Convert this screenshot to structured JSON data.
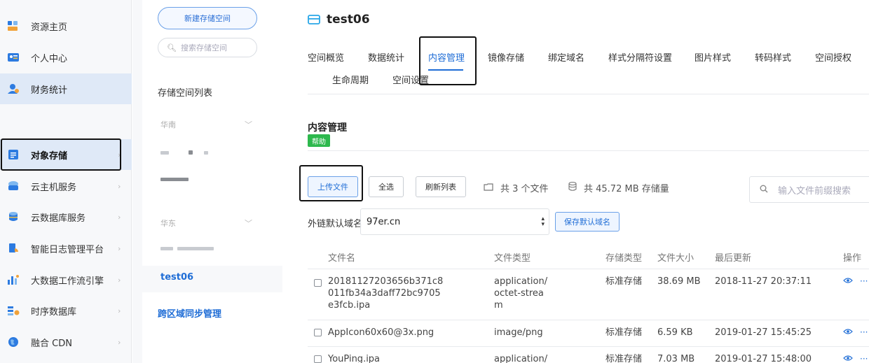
{
  "nav": {
    "items": [
      {
        "label": "资源主页",
        "icon": "resource-home-icon"
      },
      {
        "label": "个人中心",
        "icon": "profile-card-icon"
      },
      {
        "label": "财务统计",
        "icon": "finance-user-icon"
      },
      {
        "label": "对象存储",
        "icon": "object-storage-icon"
      },
      {
        "label": "云主机服务",
        "icon": "cloud-host-icon"
      },
      {
        "label": "云数据库服务",
        "icon": "cloud-database-icon"
      },
      {
        "label": "智能日志管理平台",
        "icon": "log-platform-icon"
      },
      {
        "label": "大数据工作流引擎",
        "icon": "bigdata-workflow-icon"
      },
      {
        "label": "时序数据库",
        "icon": "timeseries-db-icon"
      },
      {
        "label": "融合 CDN",
        "icon": "cdn-globe-icon"
      }
    ]
  },
  "buckets": {
    "new_button": "新建存储空间",
    "search_placeholder": "搜索存储空间",
    "list_title": "存储空间列表",
    "regions": [
      "华南",
      "华东"
    ],
    "active_bucket": "test06",
    "cross_region_link": "跨区域同步管理"
  },
  "space": {
    "title": "test06",
    "tabs": [
      "空间概览",
      "数据统计",
      "内容管理",
      "镜像存储",
      "绑定域名",
      "样式分隔符设置",
      "图片样式",
      "转码样式",
      "空间授权",
      "生命周期",
      "空间设置"
    ],
    "active_tab": "内容管理"
  },
  "content": {
    "section_title": "内容管理",
    "help_badge": "帮助",
    "upload_button": "上传文件",
    "select_all_button": "全选",
    "refresh_button": "刷新列表",
    "file_count": "共 3 个文件",
    "storage_total": "共 45.72 MB 存储量",
    "search_placeholder": "输入文件前缀搜索",
    "domain_label": "外链默认域名",
    "domain_value": "97er.cn",
    "save_domain_button": "保存默认域名",
    "columns": [
      "文件名",
      "文件类型",
      "存储类型",
      "文件大小",
      "最后更新",
      "操作"
    ],
    "files": [
      {
        "name": [
          "20181127203656b371c8",
          "011fb34a3daff72bc9705",
          "e3fcb.ipa"
        ],
        "type": [
          "application/",
          "octet-strea",
          "m"
        ],
        "storage": "标准存储",
        "size": "38.69 MB",
        "updated": "2018-11-27 20:37:11"
      },
      {
        "name": [
          "AppIcon60x60@3x.png"
        ],
        "type": [
          "image/png"
        ],
        "storage": "标准存储",
        "size": "6.59 KB",
        "updated": "2019-01-27 15:45:25"
      },
      {
        "name": [
          "YouPing.ipa"
        ],
        "type": [
          "application/"
        ],
        "storage": "标准存储",
        "size": "7.03 MB",
        "updated": "2019-01-27 15:48:00"
      }
    ]
  },
  "colors": {
    "accent": "#1f6dd6",
    "help_green": "#2db84d",
    "nav_active_bg": "#dfe9f7"
  }
}
